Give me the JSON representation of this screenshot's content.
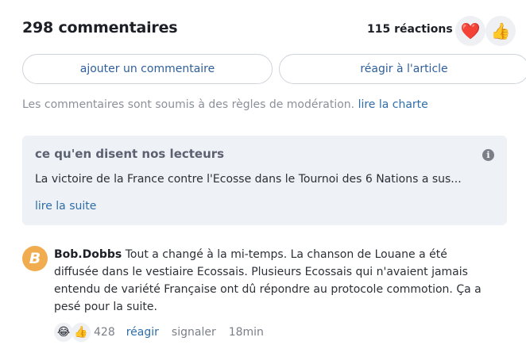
{
  "header": {
    "title": "298 commentaires",
    "reactions_label": "115 réactions",
    "reaction_emojis": [
      "❤️",
      "👍"
    ]
  },
  "actions": {
    "add_comment": "ajouter un commentaire",
    "react_article": "réagir à l'article"
  },
  "moderation": {
    "text": "Les commentaires sont soumis à des règles de modération.",
    "link": "lire la charte"
  },
  "readers": {
    "title": "ce qu'en disent nos lecteurs",
    "excerpt": "La victoire de la France contre l'Ecosse dans le Tournoi des 6 Nations a sus...",
    "read_more": "lire la suite",
    "info_icon": "info-icon"
  },
  "comment": {
    "avatar_letter": "B",
    "author": "Bob.Dobbs",
    "text": "Tout a changé à la mi-temps. La chanson de Louane a été diffusée dans le vestiaire Ecossais. Plusieurs Ecossais qui n'avaient jamais entendu de variété Française ont dû répondre au protocole commotion. Ça a pesé pour la suite.",
    "reaction_emojis": [
      "😂",
      "👍"
    ],
    "reaction_count": "428",
    "reply": "réagir",
    "report": "signaler",
    "time": "18min"
  },
  "colors": {
    "link": "#2f6ea8",
    "avatar": "#f1ac50",
    "panel_bg": "#eef1f6"
  }
}
